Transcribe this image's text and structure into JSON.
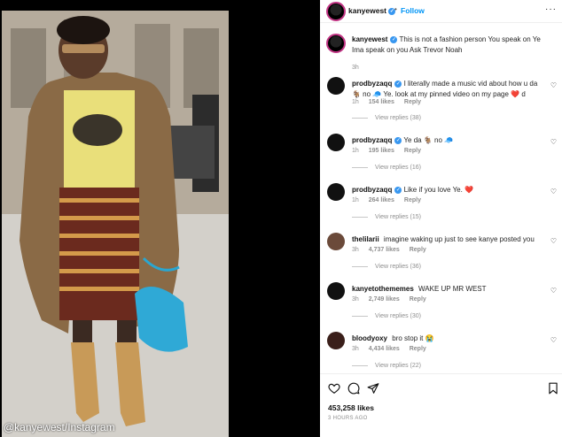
{
  "photo": {
    "watermark": "@kanyewest/Instagram"
  },
  "post": {
    "author": "kanyewest",
    "follow_label": "Follow",
    "more_label": "···",
    "caption": {
      "user": "kanyewest",
      "text": "This is not a fashion person You speak on Ye Ima speak on you Ask Trevor Noah",
      "time": "3h"
    },
    "comments": [
      {
        "user": "prodbyzaqq",
        "text": "I literally made a music vid about how u da 🐐 no 🧢 Ye. look at my pinned video on my page ❤️ d",
        "time": "1h",
        "likes": "154 likes",
        "reply": "Reply",
        "view_replies": "View replies (38)"
      },
      {
        "user": "prodbyzaqq",
        "text": "Ye da 🐐 no 🧢",
        "time": "1h",
        "likes": "195 likes",
        "reply": "Reply",
        "view_replies": "View replies (16)"
      },
      {
        "user": "prodbyzaqq",
        "text": "Like if you love Ye. ❤️",
        "time": "1h",
        "likes": "264 likes",
        "reply": "Reply",
        "view_replies": "View replies (15)"
      },
      {
        "user": "thelilarii",
        "text": "imagine waking up just to see kanye posted you",
        "time": "3h",
        "likes": "4,737 likes",
        "reply": "Reply",
        "view_replies": "View replies (36)"
      },
      {
        "user": "kanyetothememes",
        "text": "WAKE UP MR WEST",
        "time": "3h",
        "likes": "2,749 likes",
        "reply": "Reply",
        "view_replies": "View replies (30)"
      },
      {
        "user": "bloodyoxy",
        "text": "bro stop it 😭",
        "time": "3h",
        "likes": "4,434 likes",
        "reply": "Reply",
        "view_replies": "View replies (22)"
      }
    ],
    "likes_count": "453,258 likes",
    "posted_ago": "3 HOURS AGO"
  }
}
